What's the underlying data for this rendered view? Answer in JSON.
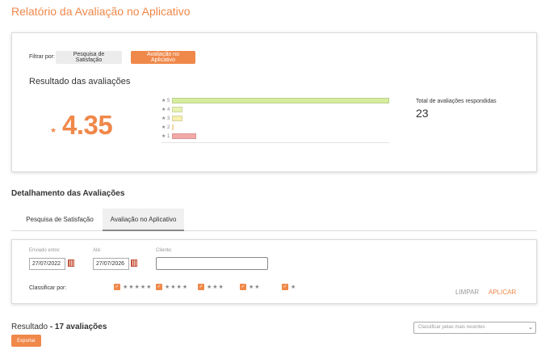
{
  "page": {
    "title": "Relatório da Avaliação no Aplicativo"
  },
  "summary": {
    "filter_label": "Filtrar por:",
    "filter_buttons": [
      "Pesquisa de Satisfação",
      "Avaliação no Aplicativo"
    ],
    "active_filter": "Avaliação no Aplicativo",
    "results_title": "Resultado das avaliações",
    "average": "4.35",
    "star_glyph": "★",
    "total_label": "Total de avaliações respondidas",
    "total_value": "23",
    "distribution": [
      {
        "label": "★ 5",
        "share": 1.0,
        "color": "#d6ed9e"
      },
      {
        "label": "★ 4",
        "share": 0.05,
        "color": "#e9f2b4"
      },
      {
        "label": "★ 3",
        "share": 0.05,
        "color": "#f6efb0"
      },
      {
        "label": "★ 2",
        "share": 0.0,
        "color": "#f2d9a0"
      },
      {
        "label": "★ 1",
        "share": 0.11,
        "color": "#f4a9a9"
      }
    ]
  },
  "details": {
    "title": "Detalhamento das Avaliações",
    "tabs": [
      "Pesquisa de Satisfação",
      "Avaliação no Aplicativo"
    ],
    "active_tab": "Avaliação no Aplicativo",
    "sent_between_label": "Enviado entre:",
    "sent_from": "27/07/2022",
    "until_label": "Até:",
    "sent_to": "27/07/2026",
    "client_label": "Cliente:",
    "client_value": "",
    "sort_by_label": "Classificar por:",
    "star_filters": [
      "★★★★★",
      "★★★★",
      "★★★",
      "★★",
      "★"
    ],
    "clear_label": "LIMPAR",
    "apply_label": "APLICAR"
  },
  "results": {
    "prefix": "Resultado",
    "count_text": "- 17 avaliações",
    "sort_selected": "Classificar pelas mais recentes",
    "export_label": "Exportar"
  }
}
